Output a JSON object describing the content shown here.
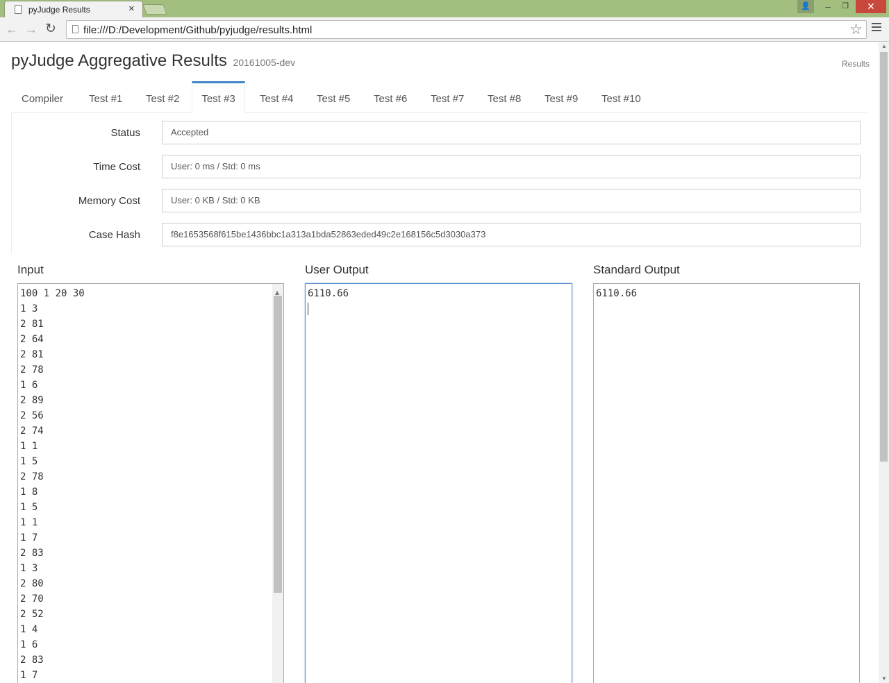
{
  "browser": {
    "tab_title": "pyJudge Results",
    "tab_close": "×",
    "url": "file:///D:/Development/Github/pyjudge/results.html",
    "window_close": "✕",
    "window_min": "‒",
    "window_max": "❐"
  },
  "header": {
    "title": "pyJudge Aggregative Results",
    "version": "20161005-dev",
    "nav_link": "Results"
  },
  "tabs": [
    {
      "label": "Compiler"
    },
    {
      "label": "Test #1"
    },
    {
      "label": "Test #2"
    },
    {
      "label": "Test #3",
      "active": true
    },
    {
      "label": "Test #4"
    },
    {
      "label": "Test #5"
    },
    {
      "label": "Test #6"
    },
    {
      "label": "Test #7"
    },
    {
      "label": "Test #8"
    },
    {
      "label": "Test #9"
    },
    {
      "label": "Test #10"
    }
  ],
  "details": {
    "status_label": "Status",
    "status_value": "Accepted",
    "time_label": "Time Cost",
    "time_value": "User: 0 ms / Std: 0 ms",
    "memory_label": "Memory Cost",
    "memory_value": "User: 0 KB / Std: 0 KB",
    "hash_label": "Case Hash",
    "hash_value": "f8e1653568f615be1436bbc1a313a1bda52863eded49c2e168156c5d3030a373"
  },
  "io": {
    "input_title": "Input",
    "user_output_title": "User Output",
    "standard_output_title": "Standard Output",
    "input_lines": [
      "100 1 20 30",
      "1 3",
      "2 81",
      "2 64",
      "2 81",
      "2 78",
      "1 6",
      "2 89",
      "2 56",
      "2 74",
      "1 1",
      "1 5",
      "2 78",
      "1 8",
      "1 5",
      "1 1",
      "1 7",
      "2 83",
      "1 3",
      "2 80",
      "2 70",
      "2 52",
      "1 4",
      "1 6",
      "2 83",
      "1 7"
    ],
    "user_output": "6110.66",
    "standard_output": "6110.66"
  }
}
